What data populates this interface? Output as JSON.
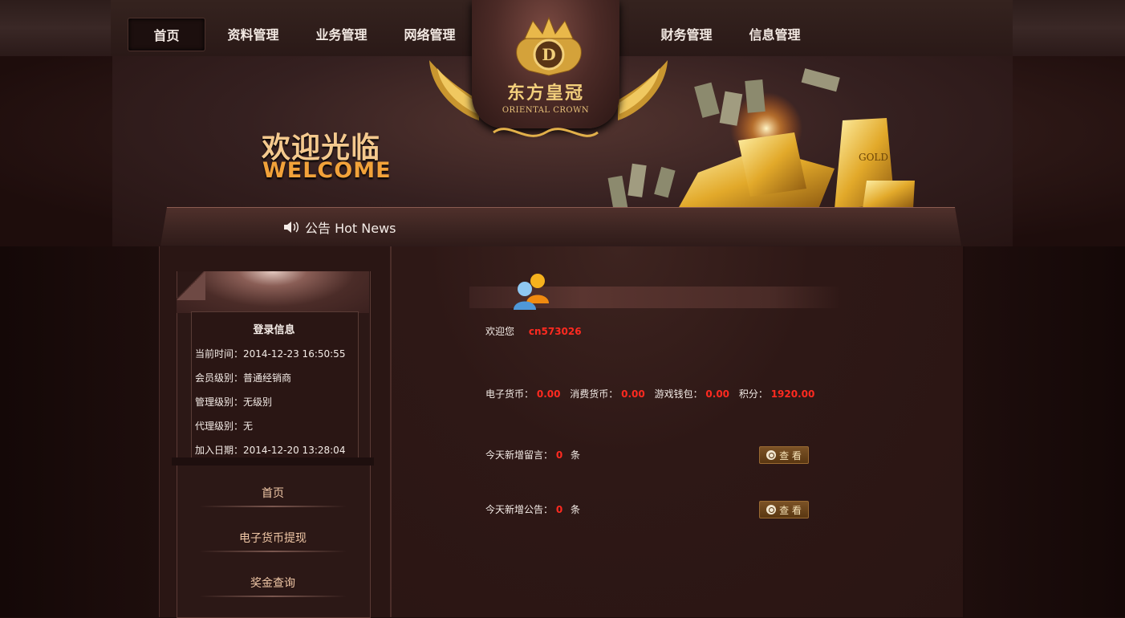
{
  "nav": {
    "items": [
      {
        "label": "首页",
        "active": true
      },
      {
        "label": "资料管理"
      },
      {
        "label": "业务管理"
      },
      {
        "label": "网络管理"
      },
      {
        "label": "财务管理"
      },
      {
        "label": "信息管理"
      }
    ]
  },
  "logo": {
    "title_cn": "东方皇冠",
    "title_en": "ORIENTAL CROWN",
    "emblem_letter": "D"
  },
  "banner": {
    "welcome_cn": "欢迎光临",
    "welcome_en": "WELCOME"
  },
  "news": {
    "label": "公告 Hot News",
    "icon": "speaker-icon"
  },
  "sidebar": {
    "login": {
      "title": "登录信息",
      "lines": [
        "当前时间：2014-12-23 16:50:55",
        "会员级别：普通经销商",
        "管理级别：无级别",
        "代理级别：无",
        "加入日期：2014-12-20 13:28:04"
      ]
    },
    "menu": [
      {
        "label": "首页"
      },
      {
        "label": "电子货币提现"
      },
      {
        "label": "奖金查询"
      }
    ]
  },
  "content": {
    "welcome_label": "欢迎您",
    "username": "cn573026",
    "balances": {
      "ecash_label": "电子货币：",
      "ecash_value": "0.00",
      "consume_label": "消费货币：",
      "consume_value": "0.00",
      "wallet_label": "游戏钱包：",
      "wallet_value": "0.00",
      "points_label": "积分：",
      "points_value": "1920.00"
    },
    "messages": {
      "label": "今天新增留言：",
      "count": "0",
      "unit": "条"
    },
    "notices": {
      "label": "今天新增公告：",
      "count": "0",
      "unit": "条"
    },
    "view_button": "查 看"
  },
  "colors": {
    "accent_red": "#ff2a20",
    "gold": "#f2a23a",
    "bg_dark": "#2a1614"
  }
}
